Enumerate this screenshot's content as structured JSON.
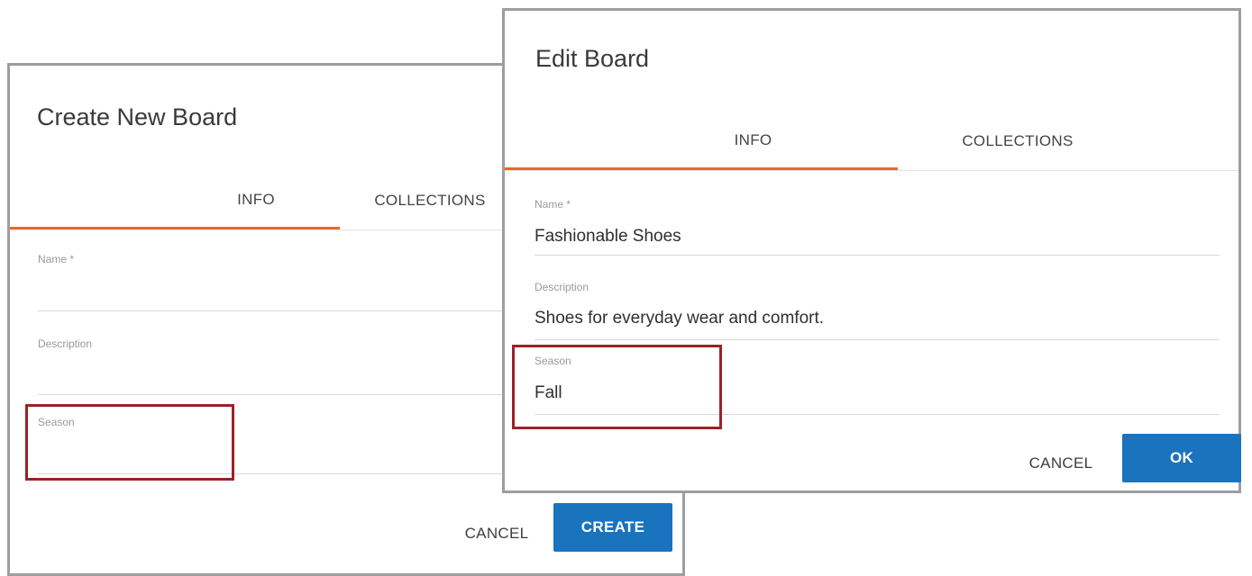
{
  "create_dialog": {
    "title": "Create New Board",
    "tabs": {
      "info": "INFO",
      "collections": "COLLECTIONS"
    },
    "fields": {
      "name": {
        "label": "Name *",
        "value": ""
      },
      "description": {
        "label": "Description",
        "value": ""
      },
      "season": {
        "label": "Season",
        "value": ""
      }
    },
    "cancel_label": "CANCEL",
    "create_label": "CREATE"
  },
  "edit_dialog": {
    "title": "Edit Board",
    "tabs": {
      "info": "INFO",
      "collections": "COLLECTIONS"
    },
    "fields": {
      "name": {
        "label": "Name *",
        "value": "Fashionable Shoes"
      },
      "description": {
        "label": "Description",
        "value": "Shoes for everyday wear and comfort."
      },
      "season": {
        "label": "Season",
        "value": "Fall"
      }
    },
    "cancel_label": "CANCEL",
    "ok_label": "OK"
  },
  "colors": {
    "accent_tab": "#f26522",
    "primary_button": "#1a73bd",
    "highlight_box": "#9b2226",
    "dialog_border": "#9e9e9e"
  }
}
